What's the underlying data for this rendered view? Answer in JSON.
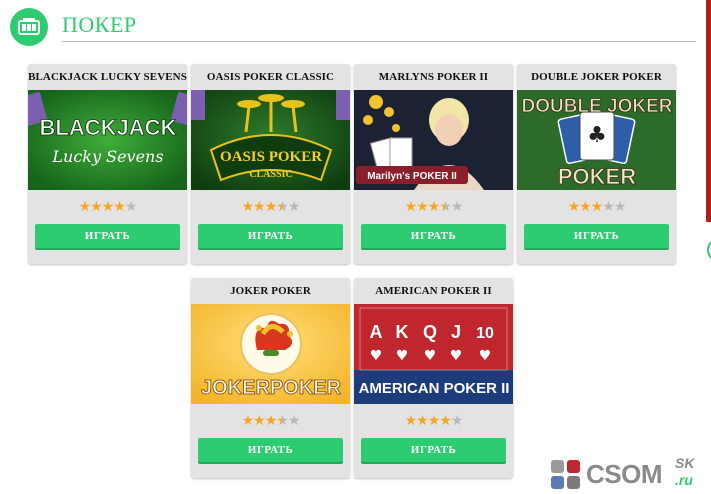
{
  "section": {
    "title": "ПОКЕР",
    "icon": "slot-machine-icon"
  },
  "accent_color": "#2ecc71",
  "games": [
    {
      "title": "BLACKJACK LUCKY SEVENS",
      "rating": 4,
      "play_label": "ИГРАТЬ",
      "art_lines": [
        "BLACKJACK",
        "Lucky Sevens"
      ]
    },
    {
      "title": "OASIS POKER CLASSIC",
      "rating": 3.5,
      "play_label": "ИГРАТЬ",
      "art_lines": [
        "OASIS POKER",
        "CLASSIC"
      ]
    },
    {
      "title": "MARLYNS POKER II",
      "rating": 3.5,
      "play_label": "ИГРАТЬ",
      "art_lines": [
        "Marilyn's POKER II"
      ]
    },
    {
      "title": "DOUBLE JOKER POKER",
      "rating": 3,
      "play_label": "ИГРАТЬ",
      "art_lines": [
        "DOUBLE JOKER",
        "POKER"
      ]
    },
    {
      "title": "JOKER POKER",
      "rating": 3.5,
      "play_label": "ИГРАТЬ",
      "art_lines": [
        "JOKERPOKER"
      ]
    },
    {
      "title": "AMERICAN POKER II",
      "rating": 4,
      "play_label": "ИГРАТЬ",
      "art_lines": [
        "A",
        "K",
        "Q",
        "J",
        "10",
        "AMERICAN POKER II"
      ]
    }
  ],
  "watermark": {
    "text": "CSOM",
    "sub": "SK",
    "domain": ".ru"
  }
}
